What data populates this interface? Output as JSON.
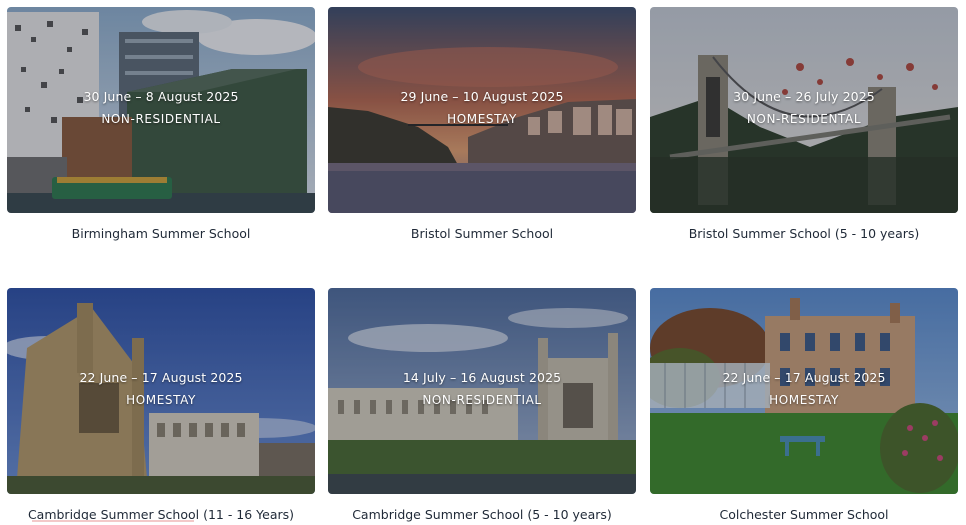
{
  "courses": [
    {
      "title": "Birmingham Summer School",
      "dates": "30 June – 8 August 2025",
      "type": "NON-RESIDENTIAL"
    },
    {
      "title": "Bristol Summer School",
      "dates": "29 June – 10 August 2025",
      "type": "HOMESTAY"
    },
    {
      "title": "Bristol Summer School (5 - 10 years)",
      "dates": "30 June – 26 July 2025",
      "type": "NON-RESIDENTAL"
    },
    {
      "title": "Cambridge Summer School (11 - 16 Years)",
      "dates": "22 June – 17 August 2025",
      "type": "HOMESTAY"
    },
    {
      "title": "Cambridge Summer School (5 - 10 years)",
      "dates": "14 July – 16 August 2025",
      "type": "NON-RESIDENTIAL"
    },
    {
      "title": "Colchester Summer School",
      "dates": "22 June – 17 August 2025",
      "type": "HOMESTAY"
    }
  ]
}
